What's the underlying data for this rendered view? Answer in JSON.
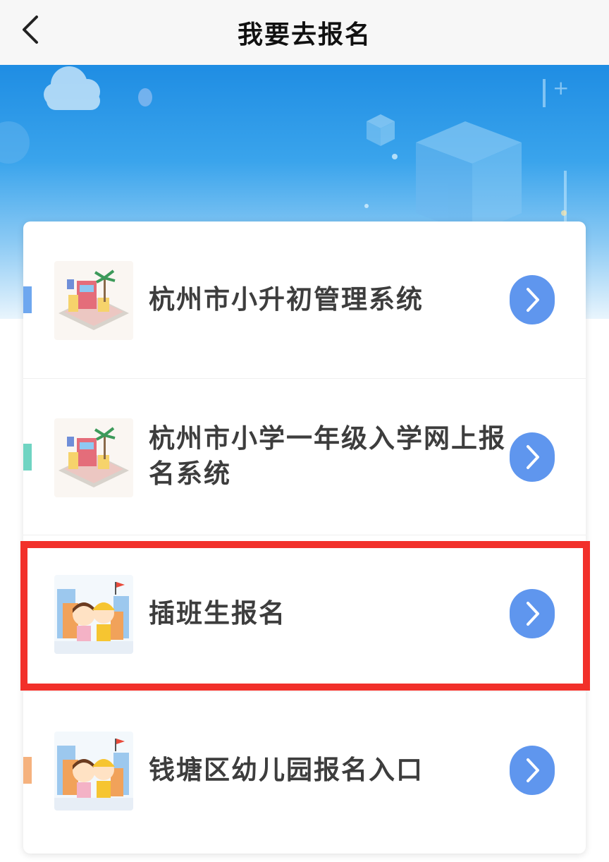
{
  "header": {
    "title": "我要去报名",
    "back_icon": "chevron-left-icon"
  },
  "colors": {
    "arrow_button": "#5f96ee",
    "highlight_border": "#f2302a",
    "accent_row1": "#6ea7ef",
    "accent_row2": "#6fd4c2",
    "accent_row4": "#f5b27e"
  },
  "list": {
    "items": [
      {
        "label": "杭州市小升初管理系统",
        "icon": "school-building-icon",
        "arrow_icon": "chevron-right-icon"
      },
      {
        "label": "杭州市小学一年级入学网上报名系统",
        "icon": "school-building-icon",
        "arrow_icon": "chevron-right-icon"
      },
      {
        "label": "插班生报名",
        "icon": "children-cartoon-icon",
        "arrow_icon": "chevron-right-icon"
      },
      {
        "label": "钱塘区幼儿园报名入口",
        "icon": "children-cartoon-icon",
        "arrow_icon": "chevron-right-icon"
      }
    ]
  }
}
